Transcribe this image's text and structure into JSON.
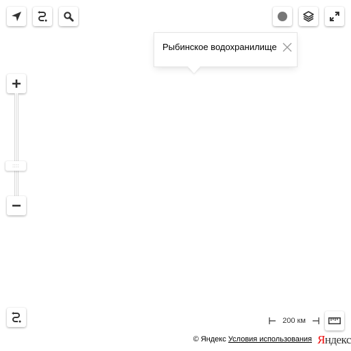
{
  "controls": {
    "geolocation_icon": "arrow-icon",
    "route_icon": "route-icon",
    "search_icon": "search-icon",
    "traffic_icon": "traffic-icon",
    "layers_icon": "layers-icon",
    "fullscreen_icon": "expand-icon"
  },
  "zoom": {
    "thumb_glyph": "::::",
    "level_fraction": 0.62
  },
  "balloon": {
    "title": "Рыбинское водохранилище"
  },
  "scale": {
    "label": "200 км"
  },
  "footer": {
    "copyright": "© Яндекс",
    "terms": "Условия использования",
    "logo_first": "Я",
    "logo_rest": "ндекс",
    "logo_color": "#ee0000"
  }
}
